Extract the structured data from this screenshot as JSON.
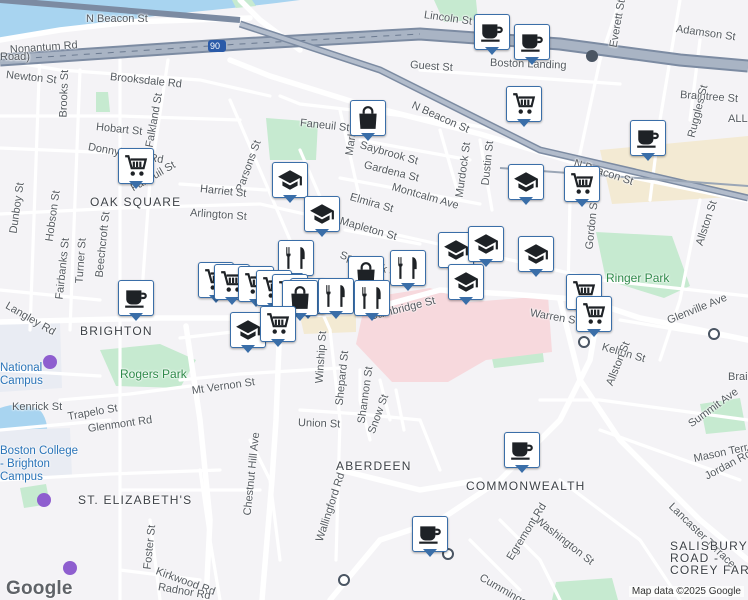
{
  "map": {
    "attribution": "Map data ©2025 Google",
    "logo_text": "Google",
    "colors": {
      "land": "#f4f3f6",
      "park": "#c6ead0",
      "road": "#ffffff",
      "highway": "#8d9aae",
      "water": "#a8d4f0",
      "hospital": "#f7d9dd",
      "campus": "#e9ecf3",
      "pin_border": "#3a6ea8",
      "pin_icon": "#1e2226"
    },
    "labels": [
      {
        "id": "n-beacon-st-top",
        "text": "N Beacon St"
      },
      {
        "id": "nonantum-rd",
        "text": "Nonantum Rd"
      },
      {
        "id": "lincoln-st",
        "text": "Lincoln St"
      },
      {
        "id": "adamson-st",
        "text": "Adamson St"
      },
      {
        "id": "guest-st",
        "text": "Guest St"
      },
      {
        "id": "boston-landing",
        "text": "Boston Landing"
      },
      {
        "id": "everett-st",
        "text": "Everett St"
      },
      {
        "id": "newton-st",
        "text": "Newton St"
      },
      {
        "id": "brooksdale-rd",
        "text": "Brooksdale Rd"
      },
      {
        "id": "brooks-st",
        "text": "Brooks St"
      },
      {
        "id": "falkland-st",
        "text": "Falkland St"
      },
      {
        "id": "hobart-st",
        "text": "Hobart St"
      },
      {
        "id": "donnybrook-rd",
        "text": "Donnybrook Rd"
      },
      {
        "id": "faneuil-st-west",
        "text": "Faneuil St"
      },
      {
        "id": "faneuil-st-north",
        "text": "Faneuil St"
      },
      {
        "id": "parsons-st",
        "text": "Parsons St"
      },
      {
        "id": "braintree-st",
        "text": "Braintree St"
      },
      {
        "id": "n-beacon-st-mid",
        "text": "N Beacon St"
      },
      {
        "id": "n-beacon-st-east",
        "text": "N Beacon St"
      },
      {
        "id": "market-st",
        "text": "Market St"
      },
      {
        "id": "glenville-st-north",
        "text": "Ruggles St"
      },
      {
        "id": "saybrook-st",
        "text": "Saybrook St"
      },
      {
        "id": "gardena-st",
        "text": "Gardena St"
      },
      {
        "id": "murdock-st",
        "text": "Murdock St"
      },
      {
        "id": "dustin-st",
        "text": "Dustin St"
      },
      {
        "id": "harriet-st",
        "text": "Harriet St"
      },
      {
        "id": "montcalm-ave",
        "text": "Montcalm Ave"
      },
      {
        "id": "elmira-st",
        "text": "Elmira St"
      },
      {
        "id": "oak-square",
        "text": "OAK SQUARE"
      },
      {
        "id": "dunboy-st",
        "text": "Dunboy St"
      },
      {
        "id": "hobson-st",
        "text": "Hobson St"
      },
      {
        "id": "arlington-st",
        "text": "Arlington St"
      },
      {
        "id": "mapleton-st",
        "text": "Mapleton St"
      },
      {
        "id": "gordon-st",
        "text": "Gordon St"
      },
      {
        "id": "allston-st-north",
        "text": "Allston St"
      },
      {
        "id": "spring-st",
        "text": "Sparhawk St"
      },
      {
        "id": "turner-st",
        "text": "Turner St"
      },
      {
        "id": "fairbanks-st",
        "text": "Fairbanks St"
      },
      {
        "id": "beechcroft-st",
        "text": "Beechcroft St"
      },
      {
        "id": "ringer-park",
        "text": "Ringer Park"
      },
      {
        "id": "cambridge-st",
        "text": "Cambridge St"
      },
      {
        "id": "warren-st",
        "text": "Warren St"
      },
      {
        "id": "glenville-ave",
        "text": "Glenville Ave"
      },
      {
        "id": "brighton-area",
        "text": "BRIGHTON"
      },
      {
        "id": "langley-rd",
        "text": "Langley Rd"
      },
      {
        "id": "kelton-st",
        "text": "Kelton St"
      },
      {
        "id": "national-campus",
        "text": "National\nCampus"
      },
      {
        "id": "rogers-park",
        "text": "Rogers Park"
      },
      {
        "id": "mt-vernon-st",
        "text": "Mt Vernon St"
      },
      {
        "id": "winship-st",
        "text": "Winship St"
      },
      {
        "id": "shepard-st",
        "text": "Shepard St"
      },
      {
        "id": "shannon-st",
        "text": "Shannon St"
      },
      {
        "id": "kenrick-st",
        "text": "Kenrick St"
      },
      {
        "id": "trapelo-st",
        "text": "Trapelo St"
      },
      {
        "id": "glenmont-rd",
        "text": "Glenmont Rd"
      },
      {
        "id": "snow-st",
        "text": "Snow St"
      },
      {
        "id": "union-st",
        "text": "Union St"
      },
      {
        "id": "allston-st-south",
        "text": "Allston St"
      },
      {
        "id": "summit-ave",
        "text": "Summit Ave"
      },
      {
        "id": "mason-terrace",
        "text": "Mason Terrace"
      },
      {
        "id": "chestnut-hill-ave",
        "text": "Chestnut Hill Ave"
      },
      {
        "id": "bc-campus",
        "text": "Boston College\n- Brighton\nCampus"
      },
      {
        "id": "aberdeen",
        "text": "ABERDEEN"
      },
      {
        "id": "jordan-rd",
        "text": "Jordan Rd"
      },
      {
        "id": "commonwealth",
        "text": "COMMONWEALTH"
      },
      {
        "id": "st-elizabeths",
        "text": "ST. ELIZABETH'S"
      },
      {
        "id": "washington-st",
        "text": "Washington St"
      },
      {
        "id": "lancaster-terrace",
        "text": "Lancaster Terrace"
      },
      {
        "id": "wallingford-rd",
        "text": "Wallingford Rd"
      },
      {
        "id": "foster-st",
        "text": "Foster St"
      },
      {
        "id": "kirkwood-rd",
        "text": "Kirkwood Rd"
      },
      {
        "id": "egremont-rd",
        "text": "Egremont Rd"
      },
      {
        "id": "radnor-rd",
        "text": "Radnor Rd"
      },
      {
        "id": "cummings-rd",
        "text": "Cummings Rd"
      },
      {
        "id": "salisbury",
        "text": "SALISBURY\nROAD -\nCOREY FAR"
      },
      {
        "id": "route-90",
        "text": "90"
      },
      {
        "id": "road-west-edge",
        "text": "Road)"
      },
      {
        "id": "brai-edge",
        "text": "Brai"
      },
      {
        "id": "alls-edge",
        "text": "ALL"
      }
    ],
    "pins": [
      {
        "id": "pin-coffee-1",
        "type": "coffee"
      },
      {
        "id": "pin-coffee-2",
        "type": "coffee"
      },
      {
        "id": "pin-grocery-1",
        "type": "grocery"
      },
      {
        "id": "pin-shopping-1",
        "type": "shopping"
      },
      {
        "id": "pin-coffee-3",
        "type": "coffee"
      },
      {
        "id": "pin-grocery-2",
        "type": "grocery"
      },
      {
        "id": "pin-school-1",
        "type": "school"
      },
      {
        "id": "pin-grocery-3",
        "type": "grocery"
      },
      {
        "id": "pin-school-2",
        "type": "school"
      },
      {
        "id": "pin-school-3",
        "type": "school"
      },
      {
        "id": "pin-restaurant-1",
        "type": "restaurant"
      },
      {
        "id": "pin-school-4",
        "type": "school"
      },
      {
        "id": "pin-school-5",
        "type": "school"
      },
      {
        "id": "pin-school-6",
        "type": "school"
      },
      {
        "id": "pin-restaurant-2",
        "type": "restaurant"
      },
      {
        "id": "pin-shopping-2",
        "type": "shopping"
      },
      {
        "id": "pin-grocery-4",
        "type": "grocery"
      },
      {
        "id": "pin-grocery-5",
        "type": "grocery"
      },
      {
        "id": "pin-grocery-6",
        "type": "grocery"
      },
      {
        "id": "pin-grocery-7",
        "type": "grocery"
      },
      {
        "id": "pin-grocery-8",
        "type": "grocery"
      },
      {
        "id": "pin-school-7",
        "type": "school"
      },
      {
        "id": "pin-coffee-4",
        "type": "coffee"
      },
      {
        "id": "pin-grocery-9",
        "type": "grocery"
      },
      {
        "id": "pin-shopping-3",
        "type": "shopping"
      },
      {
        "id": "pin-restaurant-3",
        "type": "restaurant"
      },
      {
        "id": "pin-restaurant-4",
        "type": "restaurant"
      },
      {
        "id": "pin-grocery-10",
        "type": "grocery"
      },
      {
        "id": "pin-school-8",
        "type": "school"
      },
      {
        "id": "pin-grocery-11",
        "type": "grocery"
      },
      {
        "id": "pin-grocery-12",
        "type": "grocery"
      },
      {
        "id": "pin-coffee-5",
        "type": "coffee"
      },
      {
        "id": "pin-coffee-6",
        "type": "coffee"
      }
    ]
  }
}
